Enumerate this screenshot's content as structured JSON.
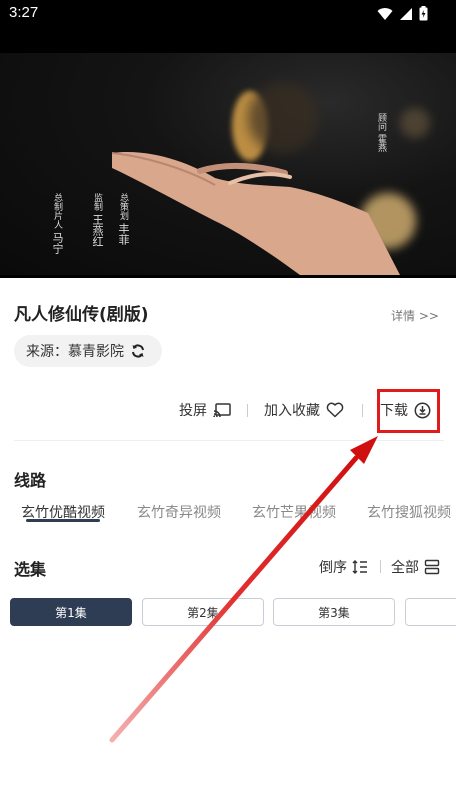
{
  "status_bar": {
    "time": "3:27"
  },
  "video": {
    "credits_left": [
      "总制片人",
      "马宁"
    ],
    "credits_mid": [
      "监制",
      "王燕红"
    ],
    "credits_mid2": [
      "总策划",
      "丰菲"
    ],
    "credits_right": [
      "顾问",
      "霍燕"
    ]
  },
  "show": {
    "title": "凡人修仙传(剧版)",
    "details_label": "详情 >>",
    "source_label": "来源：慕青影院"
  },
  "actions": {
    "cast": "投屏",
    "favorite": "加入收藏",
    "download": "下载"
  },
  "routes": {
    "heading": "线路",
    "tabs": [
      "玄竹优酷视频",
      "玄竹奇异视频",
      "玄竹芒果视频",
      "玄竹搜狐视频"
    ],
    "active_index": 0
  },
  "episodes": {
    "heading": "选集",
    "order_label": "倒序",
    "all_label": "全部",
    "items": [
      "第1集",
      "第2集",
      "第3集",
      ""
    ],
    "active_index": 0
  },
  "colors": {
    "accent": "#2f3d54",
    "annotation": "#e01b1b"
  }
}
